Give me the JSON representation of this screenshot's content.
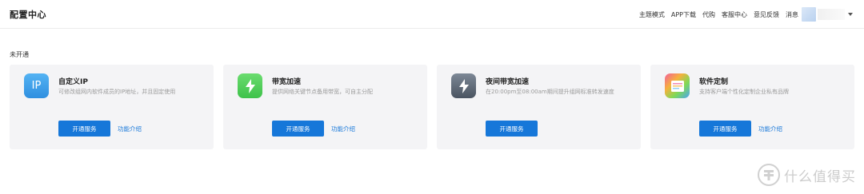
{
  "header": {
    "title": "配置中心",
    "nav": [
      "主题模式",
      "APP下载",
      "代购",
      "客服中心",
      "意见反馈",
      "消息"
    ]
  },
  "section": {
    "label": "未开通"
  },
  "cards": [
    {
      "icon": "ip-icon",
      "icon_text": "IP",
      "title": "自定义IP",
      "desc": "可修改组网内软件成员的IP地址，并且固定使用",
      "button": "开通服务",
      "link": "功能介绍"
    },
    {
      "icon": "lightning-icon",
      "title": "带宽加速",
      "desc": "提供网络关键节点备用带宽，可自主分配",
      "button": "开通服务",
      "link": "功能介绍"
    },
    {
      "icon": "lightning-dark-icon",
      "title": "夜间带宽加速",
      "desc": "在20:00pm至08:00am期间提升组网标准转发速度",
      "button": "开通服务",
      "link": ""
    },
    {
      "icon": "custom-software-icon",
      "title": "软件定制",
      "desc": "支持客户端个性化定制企业私有品牌",
      "button": "开通服务",
      "link": "功能介绍"
    }
  ],
  "watermark": {
    "text": "什么值得买"
  },
  "colors": {
    "accent": "#1677d9",
    "card_bg": "#f4f4f6"
  }
}
